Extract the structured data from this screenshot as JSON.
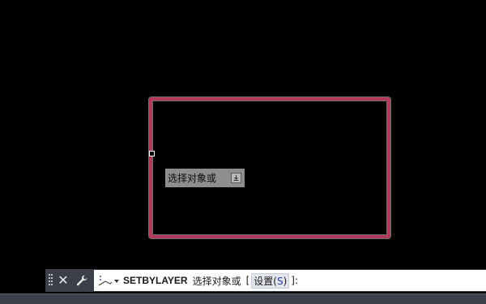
{
  "canvas": {
    "background": "#000000",
    "shape_color": "#b13a5b"
  },
  "tooltip": {
    "text": "选择对象或",
    "icon": "download-icon"
  },
  "command_line": {
    "close_icon": "close-icon",
    "customize_icon": "wrench-icon",
    "prompt_icon": "command-prompt-icon",
    "keyword": "SETBYLAYER",
    "description": "选择对象或",
    "bracket_open": "[",
    "option_label": "设置",
    "option_key_open": "(",
    "option_key": "S",
    "option_key_close": ")",
    "bracket_close": "]:"
  }
}
